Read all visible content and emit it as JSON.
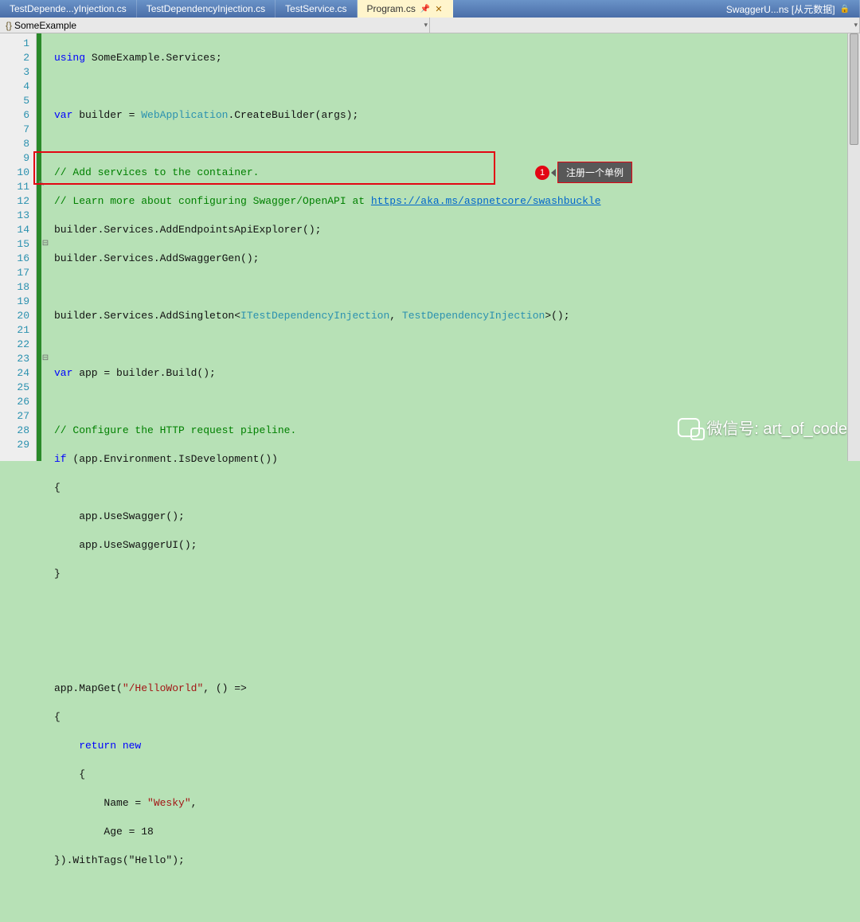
{
  "tabs": {
    "items": [
      {
        "label": "TestDepende...yInjection.cs"
      },
      {
        "label": "TestDependencyInjection.cs"
      },
      {
        "label": "TestService.cs"
      }
    ],
    "active": {
      "label": "Program.cs",
      "unsaved": "✕"
    },
    "far": {
      "label": "SwaggerU...ns [从元数据]"
    }
  },
  "nav": {
    "namespace": "SomeExample"
  },
  "gutter": [
    "1",
    "2",
    "3",
    "4",
    "5",
    "6",
    "7",
    "8",
    "9",
    "10",
    "11",
    "12",
    "13",
    "14",
    "15",
    "16",
    "17",
    "18",
    "19",
    "20",
    "21",
    "22",
    "23",
    "24",
    "25",
    "26",
    "27",
    "28",
    "29"
  ],
  "fold": [
    "",
    "",
    "",
    "",
    "",
    "",
    "",
    "",
    "",
    "",
    "",
    "",
    "",
    "",
    "⊟",
    "",
    "",
    "",
    "",
    "",
    "",
    "",
    "⊟",
    "",
    "",
    "",
    "",
    "",
    ""
  ],
  "code": {
    "l1": {
      "k1": "using",
      "t": " SomeExample.Services;"
    },
    "l3": {
      "k1": "var",
      "t1": " builder = ",
      "ty": "WebApplication",
      "t2": ".CreateBuilder(args);"
    },
    "c5": "// Add services to the container.",
    "c6a": "// Learn more about configuring Swagger/OpenAPI at ",
    "c6l": "https://aka.ms/aspnetcore/swashbuckle",
    "l7": "builder.Services.AddEndpointsApiExplorer();",
    "l8": "builder.Services.AddSwaggerGen();",
    "l10": {
      "a": "builder.Services.AddSingleton<",
      "g1": "ITestDependencyInjection",
      "b": ", ",
      "g2": "TestDependencyInjection",
      "c": ">();"
    },
    "l12": {
      "k": "var",
      "t": " app = builder.Build();"
    },
    "c14": "// Configure the HTTP request pipeline.",
    "l15": {
      "k": "if",
      "t": " (app.Environment.IsDevelopment())"
    },
    "l16": "{",
    "l17": "    app.UseSwagger();",
    "l18": "    app.UseSwaggerUI();",
    "l19": "}",
    "l23": {
      "a": "app.MapGet(",
      "s": "\"/HelloWorld\"",
      "b": ", () =>"
    },
    "l24": "{",
    "l25": {
      "k": "    return new"
    },
    "l26": "    {",
    "l27": {
      "a": "        Name = ",
      "s": "\"Wesky\"",
      "b": ","
    },
    "l28": "        Age = 18",
    "l29": "}).WithTags(\"Hello\");"
  },
  "annotation": {
    "num": "1",
    "text": "注册一个单例"
  },
  "watermark": "微信号: art_of_code"
}
